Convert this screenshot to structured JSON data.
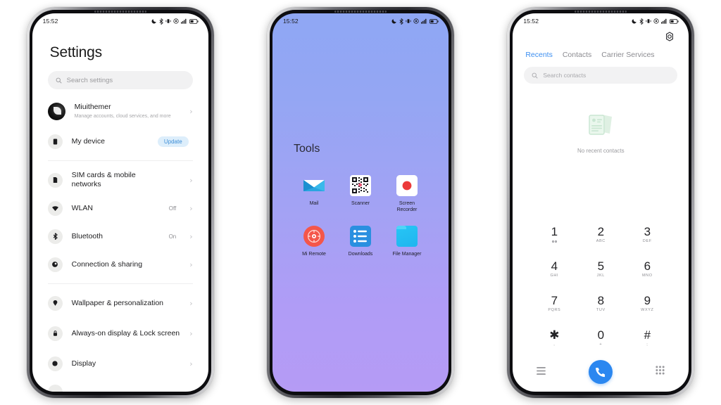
{
  "phones": {
    "settings": {
      "status": {
        "time": "15:52",
        "icons": [
          "dnd-icon",
          "bluetooth-icon",
          "vibrate-icon",
          "location-icon",
          "signal-icon",
          "battery-icon"
        ]
      },
      "title": "Settings",
      "search_placeholder": "Search settings",
      "account": {
        "name": "Miuithemer",
        "subtitle": "Manage accounts, cloud services, and more",
        "chevron": "›"
      },
      "device": {
        "label": "My device",
        "badge": "Update",
        "badge_color": "#3d8ed6",
        "badge_bg": "#ddeefb"
      },
      "items": [
        {
          "label": "SIM cards & mobile networks",
          "value": "",
          "icon": "sim-icon",
          "chevron": "›"
        },
        {
          "label": "WLAN",
          "value": "Off",
          "icon": "wifi-icon",
          "chevron": "›"
        },
        {
          "label": "Bluetooth",
          "value": "On",
          "icon": "bluetooth-icon",
          "chevron": "›"
        },
        {
          "label": "Connection & sharing",
          "value": "",
          "icon": "connection-icon",
          "chevron": "›"
        }
      ],
      "items2": [
        {
          "label": "Wallpaper & personalization",
          "value": "",
          "icon": "wallpaper-icon",
          "chevron": "›"
        },
        {
          "label": "Always-on display & Lock screen",
          "value": "",
          "icon": "lock-icon",
          "chevron": "›"
        },
        {
          "label": "Display",
          "value": "",
          "icon": "display-icon",
          "chevron": "›"
        }
      ]
    },
    "home": {
      "status": {
        "time": "15:52",
        "icons": [
          "dnd-icon",
          "bluetooth-icon",
          "vibrate-icon",
          "location-icon",
          "signal-icon",
          "battery-icon"
        ]
      },
      "folder_title": "Tools",
      "wallpaper_top": "#8fa7f4",
      "wallpaper_bottom": "#b59bf5",
      "apps": [
        {
          "label": "Mail",
          "icon": "mail-icon"
        },
        {
          "label": "Scanner",
          "icon": "qr-scanner-icon"
        },
        {
          "label": "Screen Recorder",
          "icon": "screen-recorder-icon"
        },
        {
          "label": "Mi Remote",
          "icon": "mi-remote-icon"
        },
        {
          "label": "Downloads",
          "icon": "downloads-icon"
        },
        {
          "label": "File Manager",
          "icon": "file-manager-icon"
        }
      ]
    },
    "dialer": {
      "status": {
        "time": "15:52",
        "icons": [
          "dnd-icon",
          "bluetooth-icon",
          "vibrate-icon",
          "location-icon",
          "signal-icon",
          "battery-icon"
        ]
      },
      "tabs": [
        {
          "label": "Recents",
          "active": true
        },
        {
          "label": "Contacts",
          "active": false
        },
        {
          "label": "Carrier Services",
          "active": false
        }
      ],
      "accent": "#3b8ef0",
      "search_placeholder": "Search contacts",
      "empty_label": "No recent contacts",
      "keys": [
        {
          "num": "1",
          "sub": ""
        },
        {
          "num": "2",
          "sub": "ABC"
        },
        {
          "num": "3",
          "sub": "DEF"
        },
        {
          "num": "4",
          "sub": "GHI"
        },
        {
          "num": "5",
          "sub": "JKL"
        },
        {
          "num": "6",
          "sub": "MNO"
        },
        {
          "num": "7",
          "sub": "PQRS"
        },
        {
          "num": "8",
          "sub": "TUV"
        },
        {
          "num": "9",
          "sub": "WXYZ"
        },
        {
          "num": "✱",
          "sub": ","
        },
        {
          "num": "0",
          "sub": "+"
        },
        {
          "num": "#",
          "sub": ";"
        }
      ],
      "bottom": {
        "left_icon": "list-menu-icon",
        "call_icon": "call-icon",
        "right_icon": "keypad-grid-icon"
      }
    }
  }
}
